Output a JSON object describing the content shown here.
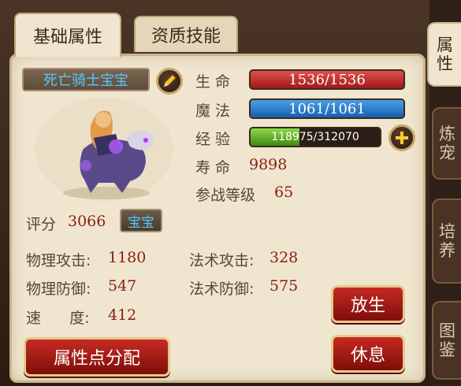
{
  "tabs": [
    "基础属性",
    "资质技能"
  ],
  "side_tabs": [
    "属性",
    "炼宠",
    "培养",
    "图鉴"
  ],
  "pet": {
    "name": "死亡骑士宝宝",
    "badge": "宝宝"
  },
  "stats": {
    "hp_label": "生  命",
    "hp_value": "1536/1536",
    "hp_fraction": 1.0,
    "mp_label": "魔  法",
    "mp_value": "1061/1061",
    "mp_fraction": 1.0,
    "exp_label": "经  验",
    "exp_value": "118975/312070",
    "exp_fraction": 0.381,
    "life_label": "寿  命",
    "life_value": "9898",
    "level_label": "参战等级",
    "level_value": "65",
    "score_label": "评分",
    "score_value": "3066",
    "phys_atk_label": "物理攻击:",
    "phys_atk_value": "1180",
    "mag_atk_label": "法术攻击:",
    "mag_atk_value": "328",
    "phys_def_label": "物理防御:",
    "phys_def_value": "547",
    "mag_def_label": "法术防御:",
    "mag_def_value": "575",
    "speed_label": "速      度:",
    "speed_value": "412"
  },
  "buttons": {
    "release": "放生",
    "rest": "休息",
    "allocate": "属性点分配"
  },
  "icons": {
    "edit": "pencil-icon",
    "add_exp": "plus-icon"
  },
  "colors": {
    "value_text": "#8a1c12",
    "name_text": "#54c8ff",
    "button_red": "#c62a22"
  }
}
